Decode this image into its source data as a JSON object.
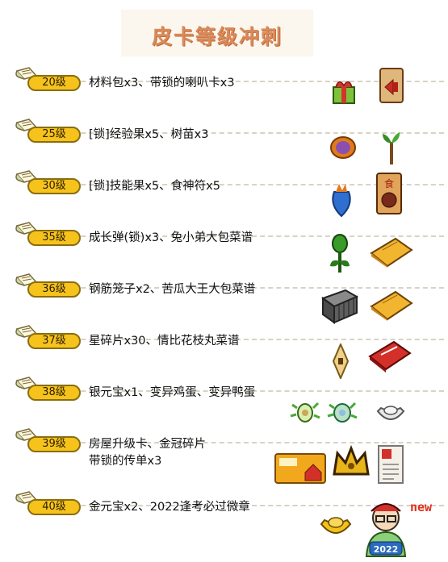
{
  "title": "皮卡等级冲刺",
  "badge_new": "new",
  "rewards": [
    {
      "level": "20级",
      "desc": "材料包x3、带锁的喇叭卡x3",
      "icons": [
        "gift-box-icon",
        "horn-card-icon"
      ]
    },
    {
      "level": "25级",
      "desc": "[锁]经验果x5、树苗x3",
      "icons": [
        "exp-fruit-icon",
        "sapling-icon"
      ]
    },
    {
      "level": "30级",
      "desc": "[锁]技能果x5、食神符x5",
      "icons": [
        "skill-fruit-icon",
        "food-god-charm-icon"
      ]
    },
    {
      "level": "35级",
      "desc": "成长弹(锁)x3、兔小弟大包菜谱",
      "icons": [
        "growth-pellet-icon",
        "recipe-book-icon"
      ]
    },
    {
      "level": "36级",
      "desc": "钢筋笼子x2、苦瓜大王大包菜谱",
      "icons": [
        "steel-cage-icon",
        "recipe-book-icon"
      ]
    },
    {
      "level": "37级",
      "desc": "星碎片x30、情比花枝丸菜谱",
      "icons": [
        "star-fragment-icon",
        "red-recipe-book-icon"
      ]
    },
    {
      "level": "38级",
      "desc": "银元宝x1、变异鸡蛋、变异鸭蛋",
      "icons": [
        "mutant-chicken-egg-icon",
        "mutant-duck-egg-icon",
        "silver-ingot-icon"
      ]
    },
    {
      "level": "39级",
      "desc": "房屋升级卡、金冠碎片\n带锁的传单x3",
      "icons": [
        "house-upgrade-card-icon",
        "golden-crown-fragment-icon",
        "flyer-icon"
      ]
    },
    {
      "level": "40级",
      "desc": "金元宝x2、2022逢考必过微章",
      "icons": [
        "gold-ingot-icon",
        "exam-badge-icon"
      ]
    }
  ]
}
